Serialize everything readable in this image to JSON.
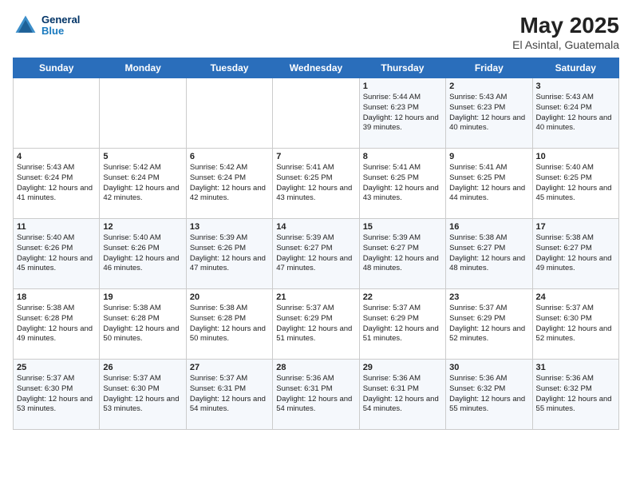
{
  "header": {
    "logo_line1": "General",
    "logo_line2": "Blue",
    "month_year": "May 2025",
    "location": "El Asintal, Guatemala"
  },
  "weekdays": [
    "Sunday",
    "Monday",
    "Tuesday",
    "Wednesday",
    "Thursday",
    "Friday",
    "Saturday"
  ],
  "weeks": [
    [
      {
        "day": "",
        "sunrise": "",
        "sunset": "",
        "daylight": ""
      },
      {
        "day": "",
        "sunrise": "",
        "sunset": "",
        "daylight": ""
      },
      {
        "day": "",
        "sunrise": "",
        "sunset": "",
        "daylight": ""
      },
      {
        "day": "",
        "sunrise": "",
        "sunset": "",
        "daylight": ""
      },
      {
        "day": "1",
        "sunrise": "Sunrise: 5:44 AM",
        "sunset": "Sunset: 6:23 PM",
        "daylight": "Daylight: 12 hours and 39 minutes."
      },
      {
        "day": "2",
        "sunrise": "Sunrise: 5:43 AM",
        "sunset": "Sunset: 6:23 PM",
        "daylight": "Daylight: 12 hours and 40 minutes."
      },
      {
        "day": "3",
        "sunrise": "Sunrise: 5:43 AM",
        "sunset": "Sunset: 6:24 PM",
        "daylight": "Daylight: 12 hours and 40 minutes."
      }
    ],
    [
      {
        "day": "4",
        "sunrise": "Sunrise: 5:43 AM",
        "sunset": "Sunset: 6:24 PM",
        "daylight": "Daylight: 12 hours and 41 minutes."
      },
      {
        "day": "5",
        "sunrise": "Sunrise: 5:42 AM",
        "sunset": "Sunset: 6:24 PM",
        "daylight": "Daylight: 12 hours and 42 minutes."
      },
      {
        "day": "6",
        "sunrise": "Sunrise: 5:42 AM",
        "sunset": "Sunset: 6:24 PM",
        "daylight": "Daylight: 12 hours and 42 minutes."
      },
      {
        "day": "7",
        "sunrise": "Sunrise: 5:41 AM",
        "sunset": "Sunset: 6:25 PM",
        "daylight": "Daylight: 12 hours and 43 minutes."
      },
      {
        "day": "8",
        "sunrise": "Sunrise: 5:41 AM",
        "sunset": "Sunset: 6:25 PM",
        "daylight": "Daylight: 12 hours and 43 minutes."
      },
      {
        "day": "9",
        "sunrise": "Sunrise: 5:41 AM",
        "sunset": "Sunset: 6:25 PM",
        "daylight": "Daylight: 12 hours and 44 minutes."
      },
      {
        "day": "10",
        "sunrise": "Sunrise: 5:40 AM",
        "sunset": "Sunset: 6:25 PM",
        "daylight": "Daylight: 12 hours and 45 minutes."
      }
    ],
    [
      {
        "day": "11",
        "sunrise": "Sunrise: 5:40 AM",
        "sunset": "Sunset: 6:26 PM",
        "daylight": "Daylight: 12 hours and 45 minutes."
      },
      {
        "day": "12",
        "sunrise": "Sunrise: 5:40 AM",
        "sunset": "Sunset: 6:26 PM",
        "daylight": "Daylight: 12 hours and 46 minutes."
      },
      {
        "day": "13",
        "sunrise": "Sunrise: 5:39 AM",
        "sunset": "Sunset: 6:26 PM",
        "daylight": "Daylight: 12 hours and 47 minutes."
      },
      {
        "day": "14",
        "sunrise": "Sunrise: 5:39 AM",
        "sunset": "Sunset: 6:27 PM",
        "daylight": "Daylight: 12 hours and 47 minutes."
      },
      {
        "day": "15",
        "sunrise": "Sunrise: 5:39 AM",
        "sunset": "Sunset: 6:27 PM",
        "daylight": "Daylight: 12 hours and 48 minutes."
      },
      {
        "day": "16",
        "sunrise": "Sunrise: 5:38 AM",
        "sunset": "Sunset: 6:27 PM",
        "daylight": "Daylight: 12 hours and 48 minutes."
      },
      {
        "day": "17",
        "sunrise": "Sunrise: 5:38 AM",
        "sunset": "Sunset: 6:27 PM",
        "daylight": "Daylight: 12 hours and 49 minutes."
      }
    ],
    [
      {
        "day": "18",
        "sunrise": "Sunrise: 5:38 AM",
        "sunset": "Sunset: 6:28 PM",
        "daylight": "Daylight: 12 hours and 49 minutes."
      },
      {
        "day": "19",
        "sunrise": "Sunrise: 5:38 AM",
        "sunset": "Sunset: 6:28 PM",
        "daylight": "Daylight: 12 hours and 50 minutes."
      },
      {
        "day": "20",
        "sunrise": "Sunrise: 5:38 AM",
        "sunset": "Sunset: 6:28 PM",
        "daylight": "Daylight: 12 hours and 50 minutes."
      },
      {
        "day": "21",
        "sunrise": "Sunrise: 5:37 AM",
        "sunset": "Sunset: 6:29 PM",
        "daylight": "Daylight: 12 hours and 51 minutes."
      },
      {
        "day": "22",
        "sunrise": "Sunrise: 5:37 AM",
        "sunset": "Sunset: 6:29 PM",
        "daylight": "Daylight: 12 hours and 51 minutes."
      },
      {
        "day": "23",
        "sunrise": "Sunrise: 5:37 AM",
        "sunset": "Sunset: 6:29 PM",
        "daylight": "Daylight: 12 hours and 52 minutes."
      },
      {
        "day": "24",
        "sunrise": "Sunrise: 5:37 AM",
        "sunset": "Sunset: 6:30 PM",
        "daylight": "Daylight: 12 hours and 52 minutes."
      }
    ],
    [
      {
        "day": "25",
        "sunrise": "Sunrise: 5:37 AM",
        "sunset": "Sunset: 6:30 PM",
        "daylight": "Daylight: 12 hours and 53 minutes."
      },
      {
        "day": "26",
        "sunrise": "Sunrise: 5:37 AM",
        "sunset": "Sunset: 6:30 PM",
        "daylight": "Daylight: 12 hours and 53 minutes."
      },
      {
        "day": "27",
        "sunrise": "Sunrise: 5:37 AM",
        "sunset": "Sunset: 6:31 PM",
        "daylight": "Daylight: 12 hours and 54 minutes."
      },
      {
        "day": "28",
        "sunrise": "Sunrise: 5:36 AM",
        "sunset": "Sunset: 6:31 PM",
        "daylight": "Daylight: 12 hours and 54 minutes."
      },
      {
        "day": "29",
        "sunrise": "Sunrise: 5:36 AM",
        "sunset": "Sunset: 6:31 PM",
        "daylight": "Daylight: 12 hours and 54 minutes."
      },
      {
        "day": "30",
        "sunrise": "Sunrise: 5:36 AM",
        "sunset": "Sunset: 6:32 PM",
        "daylight": "Daylight: 12 hours and 55 minutes."
      },
      {
        "day": "31",
        "sunrise": "Sunrise: 5:36 AM",
        "sunset": "Sunset: 6:32 PM",
        "daylight": "Daylight: 12 hours and 55 minutes."
      }
    ]
  ]
}
